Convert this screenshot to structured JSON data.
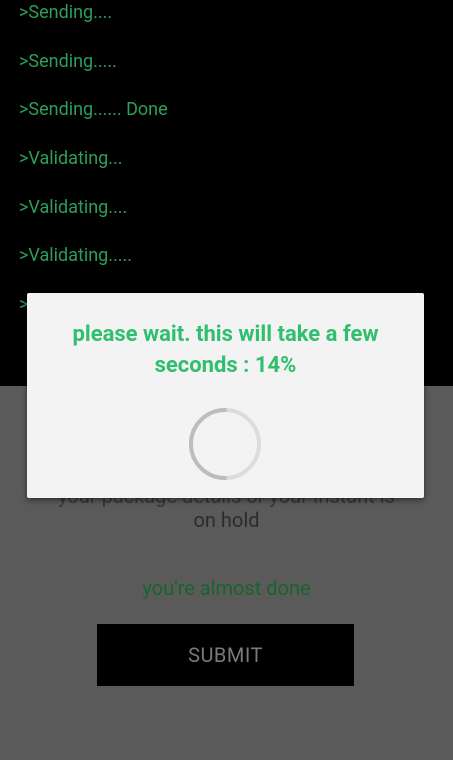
{
  "console": {
    "lines": [
      ">Sending....",
      ">Sending.....",
      ">Sending...... Done",
      ">Validating...",
      ">Validating....",
      ">Validating.....",
      ">"
    ]
  },
  "panel": {
    "hold_text_line1_partial": "your package details or your Instant is",
    "hold_text_line2": "on hold",
    "almost_done": "you're almost done",
    "submit_label": "SUBMIT"
  },
  "dialog": {
    "message_prefix": "please wait. this will take a few seconds : ",
    "percent_text": "14%",
    "progress_percent": 14
  },
  "colors": {
    "console_text": "#2e9e58",
    "dialog_text": "#2fbf6e",
    "almost_done_text": "#19642d"
  },
  "icons": {
    "spinner": "loading-spinner-icon"
  }
}
